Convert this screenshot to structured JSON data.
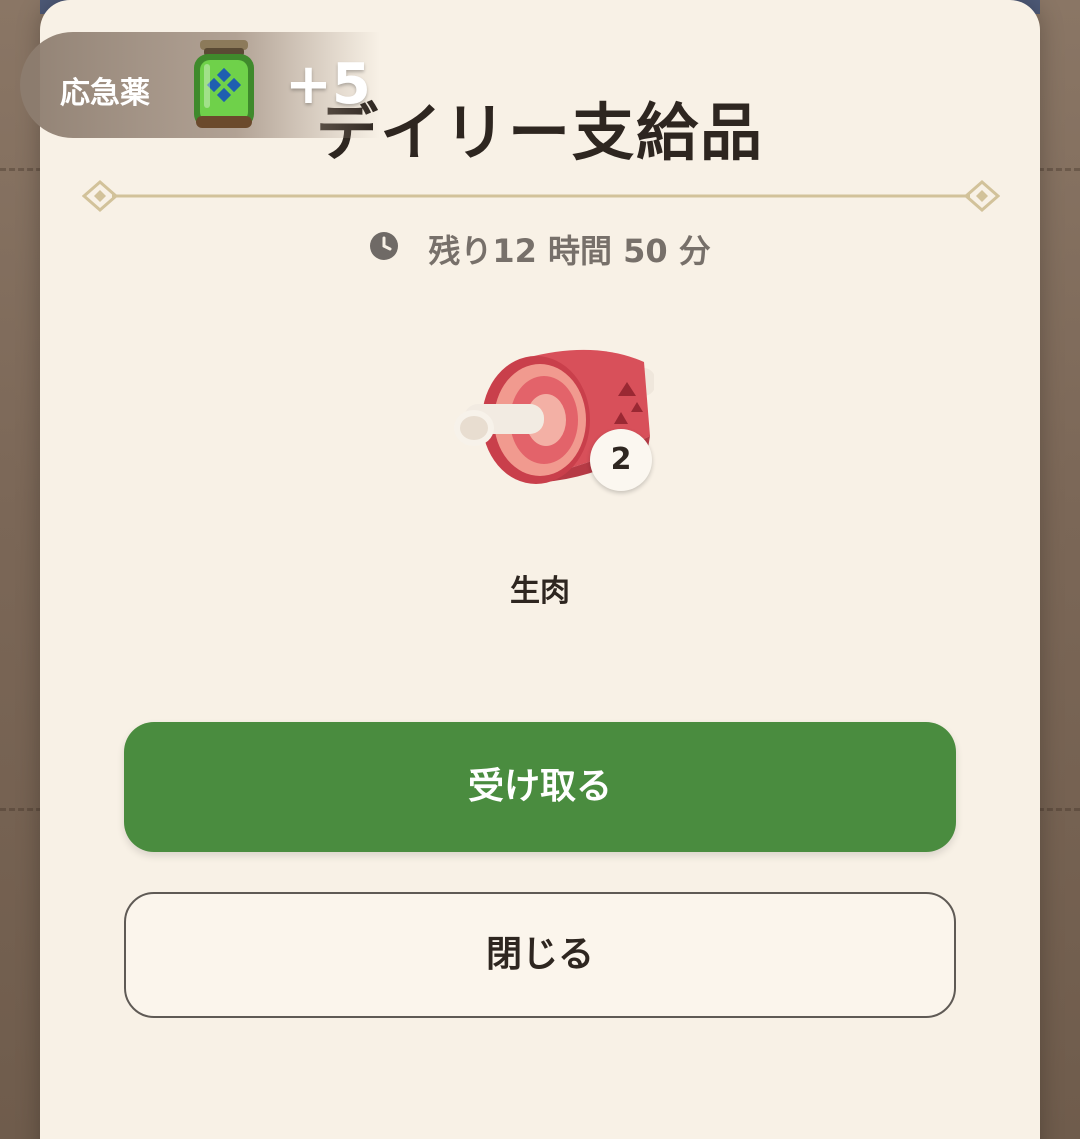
{
  "dialog": {
    "title": "デイリー支給品",
    "timer_text": "残り12 時間 50 分",
    "item": {
      "name": "生肉",
      "quantity": "2",
      "icon": "raw-meat-icon"
    },
    "buttons": {
      "receive_label": "受け取る",
      "close_label": "閉じる"
    }
  },
  "notification": {
    "label": "応急薬",
    "count": "+5",
    "icon": "potion-jar-icon"
  },
  "colors": {
    "primary_button": "#4a8c3f",
    "dialog_background": "#f8f1e6",
    "divider_gold": "#d2c29a"
  }
}
